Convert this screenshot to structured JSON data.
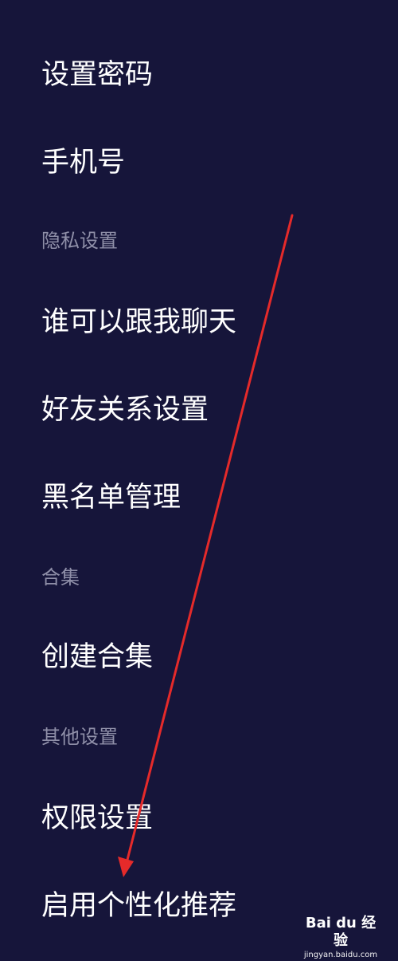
{
  "settings": {
    "items": {
      "set_password": "设置密码",
      "phone_number": "手机号",
      "privacy_section": "隐私设置",
      "who_can_chat": "谁可以跟我聊天",
      "friend_settings": "好友关系设置",
      "blacklist": "黑名单管理",
      "collection_section": "合集",
      "create_collection": "创建合集",
      "other_section": "其他设置",
      "permissions": "权限设置",
      "personalized_recommendations": "启用个性化推荐"
    }
  },
  "watermark": {
    "logo_text": "Bai du 经验",
    "url": "jingyan.baidu.com"
  },
  "colors": {
    "background": "#16153a",
    "primary_text": "#ffffff",
    "section_text": "#8f8fa8",
    "annotation_arrow": "#e52a2a"
  }
}
